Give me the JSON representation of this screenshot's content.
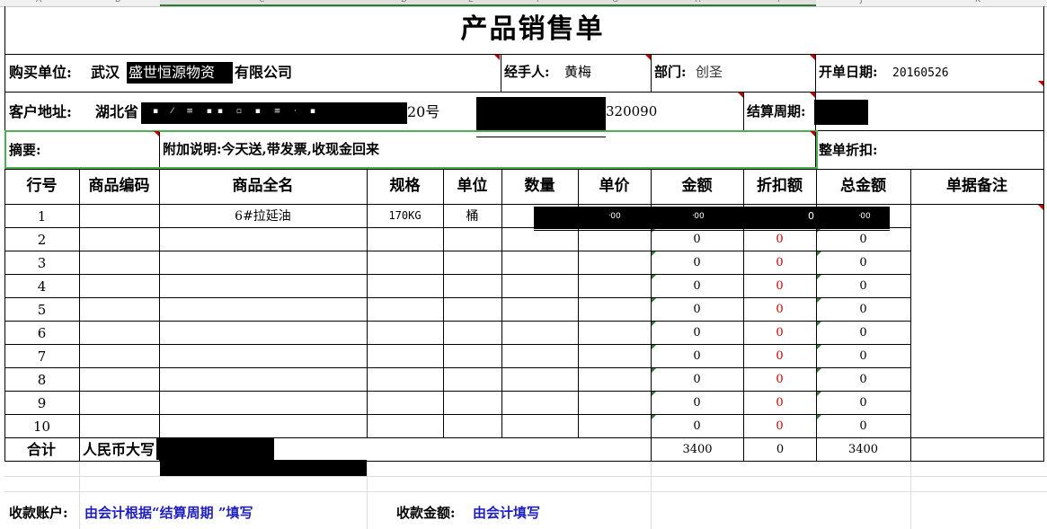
{
  "column_letters": [
    "A",
    "B",
    "C",
    "D",
    "E",
    "F",
    "G",
    "H",
    "I",
    "J",
    "K"
  ],
  "title": "产品销售单",
  "header": {
    "buyer_label": "购买单位:",
    "buyer_value_prefix": "武汉",
    "buyer_value_mid": "盛世恒源物资",
    "buyer_value_suffix": "有限公司",
    "handler_label": "经手人:",
    "handler_value": "黄梅",
    "dept_label": "部门:",
    "dept_value": "创圣",
    "date_label": "开单日期:",
    "date_value": "20160526",
    "address_label": "客户地址:",
    "address_prefix": "湖北省",
    "address_suffix": "20号",
    "phone_suffix": "320090",
    "settle_label": "结算周期:",
    "summary_label": "摘要:",
    "extra_note": "附加说明:今天送,带发票,收现金回来",
    "discount_label": "整单折扣:"
  },
  "table": {
    "columns": [
      "行号",
      "商品编码",
      "商品全名",
      "规格",
      "单位",
      "数量",
      "单价",
      "金额",
      "折扣额",
      "总金额",
      "单据备注"
    ],
    "rows": [
      {
        "no": "1",
        "code": "",
        "name": "6#拉延油",
        "spec": "170KG",
        "unit": "桶",
        "qty": "",
        "price": "",
        "amount": "",
        "discount": "",
        "total": ""
      },
      {
        "no": "2",
        "code": "",
        "name": "",
        "spec": "",
        "unit": "",
        "qty": "",
        "price": "",
        "amount": "0",
        "discount": "0",
        "total": "0"
      },
      {
        "no": "3",
        "code": "",
        "name": "",
        "spec": "",
        "unit": "",
        "qty": "",
        "price": "",
        "amount": "0",
        "discount": "0",
        "total": "0"
      },
      {
        "no": "4",
        "code": "",
        "name": "",
        "spec": "",
        "unit": "",
        "qty": "",
        "price": "",
        "amount": "0",
        "discount": "0",
        "total": "0"
      },
      {
        "no": "5",
        "code": "",
        "name": "",
        "spec": "",
        "unit": "",
        "qty": "",
        "price": "",
        "amount": "0",
        "discount": "0",
        "total": "0"
      },
      {
        "no": "6",
        "code": "",
        "name": "",
        "spec": "",
        "unit": "",
        "qty": "",
        "price": "",
        "amount": "0",
        "discount": "0",
        "total": "0"
      },
      {
        "no": "7",
        "code": "",
        "name": "",
        "spec": "",
        "unit": "",
        "qty": "",
        "price": "",
        "amount": "0",
        "discount": "0",
        "total": "0"
      },
      {
        "no": "8",
        "code": "",
        "name": "",
        "spec": "",
        "unit": "",
        "qty": "",
        "price": "",
        "amount": "0",
        "discount": "0",
        "total": "0"
      },
      {
        "no": "9",
        "code": "",
        "name": "",
        "spec": "",
        "unit": "",
        "qty": "",
        "price": "",
        "amount": "0",
        "discount": "0",
        "total": "0"
      },
      {
        "no": "10",
        "code": "",
        "name": "",
        "spec": "",
        "unit": "",
        "qty": "",
        "price": "",
        "amount": "0",
        "discount": "0",
        "total": "0"
      }
    ],
    "total_label": "合计",
    "rmb_label": "人民币大写",
    "total_amount": "3400",
    "total_discount": "0",
    "total_sum": "3400"
  },
  "footer": {
    "account_label": "收款账户:",
    "account_value": "由会计根据“结算周期 ”填写",
    "amount_label": "收款金额:",
    "amount_value": "由会计填写"
  },
  "colors": {
    "red_text": "#d00000",
    "blue_text": "#1f1fbf",
    "selection_green": "#4caf50"
  }
}
